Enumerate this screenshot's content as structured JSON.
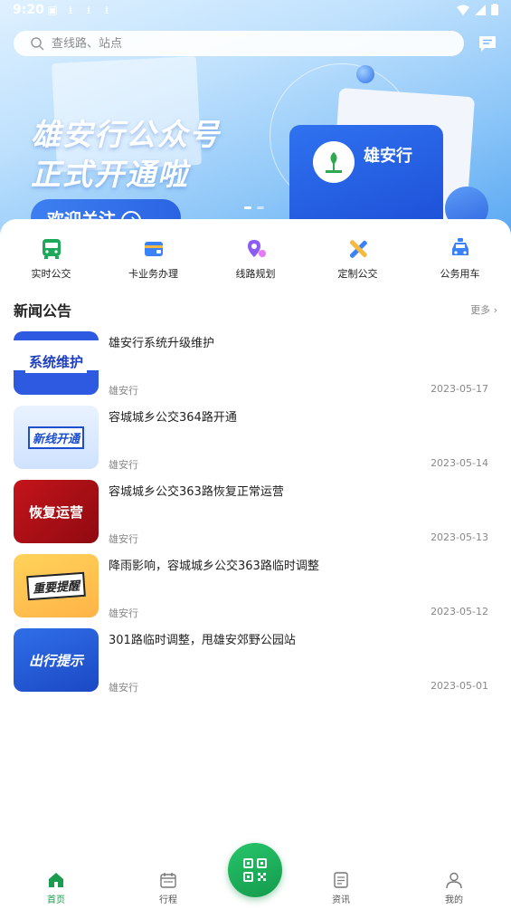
{
  "status_bar": {
    "time": "9:20"
  },
  "search": {
    "placeholder": "查线路、站点"
  },
  "banner": {
    "title_line1": "雄安行公众号",
    "title_line2": "正式开通啦",
    "follow_label": "欢迎关注",
    "brand_name": "雄安行"
  },
  "quick_nav": [
    {
      "label": "实时公交",
      "icon": "bus-icon",
      "color": "#1ea85a"
    },
    {
      "label": "卡业务办理",
      "icon": "card-wallet-icon",
      "color": "#3b82f6"
    },
    {
      "label": "线路规划",
      "icon": "route-pin-icon",
      "color": "#8b5cf6"
    },
    {
      "label": "定制公交",
      "icon": "custom-tools-icon",
      "color": "#3b82f6"
    },
    {
      "label": "公务用车",
      "icon": "official-car-icon",
      "color": "#3b82f6"
    }
  ],
  "news": {
    "title": "新闻公告",
    "more_label": "更多",
    "items": [
      {
        "headline": "雄安行系统升级维护",
        "thumb_text": "系统维护",
        "source": "雄安行",
        "date": "2023-05-17"
      },
      {
        "headline": "容城城乡公交364路开通",
        "thumb_text": "新线开通",
        "source": "雄安行",
        "date": "2023-05-14"
      },
      {
        "headline": "容城城乡公交363路恢复正常运营",
        "thumb_text": "恢复运营",
        "source": "雄安行",
        "date": "2023-05-13"
      },
      {
        "headline": "降雨影响，容城城乡公交363路临时调整",
        "thumb_text": "重要提醒",
        "source": "雄安行",
        "date": "2023-05-12"
      },
      {
        "headline": "301路临时调整，甩雄安郊野公园站",
        "thumb_text": "出行提示",
        "source": "雄安行",
        "date": "2023-05-01"
      }
    ]
  },
  "tabs": [
    {
      "label": "首页",
      "active": true
    },
    {
      "label": "行程",
      "active": false
    },
    {
      "label": "资讯",
      "active": false
    },
    {
      "label": "我的",
      "active": false
    }
  ],
  "colors": {
    "accent": "#1a9b4d",
    "banner_blue": "#5aa8f2"
  }
}
